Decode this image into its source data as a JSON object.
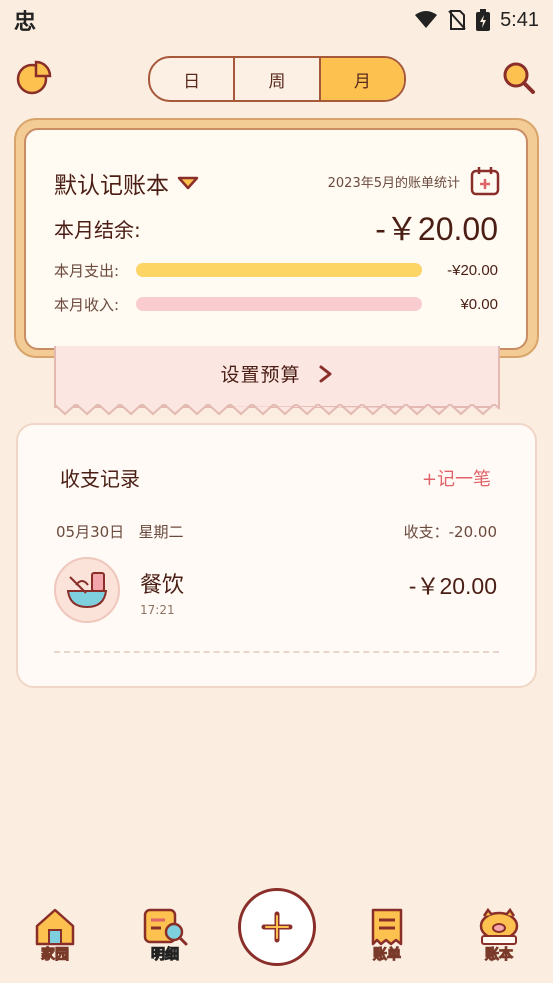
{
  "status_bar": {
    "app_glyph": "忠",
    "time": "5:41"
  },
  "top_nav": {
    "segments": [
      {
        "label": "日",
        "active": false
      },
      {
        "label": "周",
        "active": false
      },
      {
        "label": "月",
        "active": true
      }
    ]
  },
  "summary": {
    "book_title": "默认记账本",
    "stat_label": "2023年5月的账单统计",
    "balance_label": "本月结余:",
    "balance_value": "-￥20.00",
    "expense_label": "本月支出:",
    "expense_value": "-¥20.00",
    "expense_fill": 1.0,
    "income_label": "本月收入:",
    "income_value": "¥0.00",
    "income_fill": 0.0
  },
  "budget": {
    "label": "设置预算"
  },
  "records": {
    "title": "收支记录",
    "add_label": "+记一笔",
    "date": "05月30日   星期二",
    "day_summary": "收支：-20.00",
    "entries": [
      {
        "name": "餐饮",
        "time": "17:21",
        "amount": "-￥20.00",
        "icon": "dining-icon"
      }
    ]
  },
  "bottom_nav": {
    "items": [
      {
        "label": "家园",
        "icon": "home-icon"
      },
      {
        "label": "明细",
        "icon": "detail-icon",
        "active": true
      },
      {
        "label": "账单",
        "icon": "bill-icon"
      },
      {
        "label": "账本",
        "icon": "ledger-icon"
      }
    ],
    "fab_icon": "plus-icon"
  },
  "colors": {
    "background": "#fbeee0",
    "accent_yellow": "#fcc14e",
    "text_brown": "#4a1e14",
    "income_pink": "#f9cdd0",
    "add_link_red": "#e0636a"
  }
}
